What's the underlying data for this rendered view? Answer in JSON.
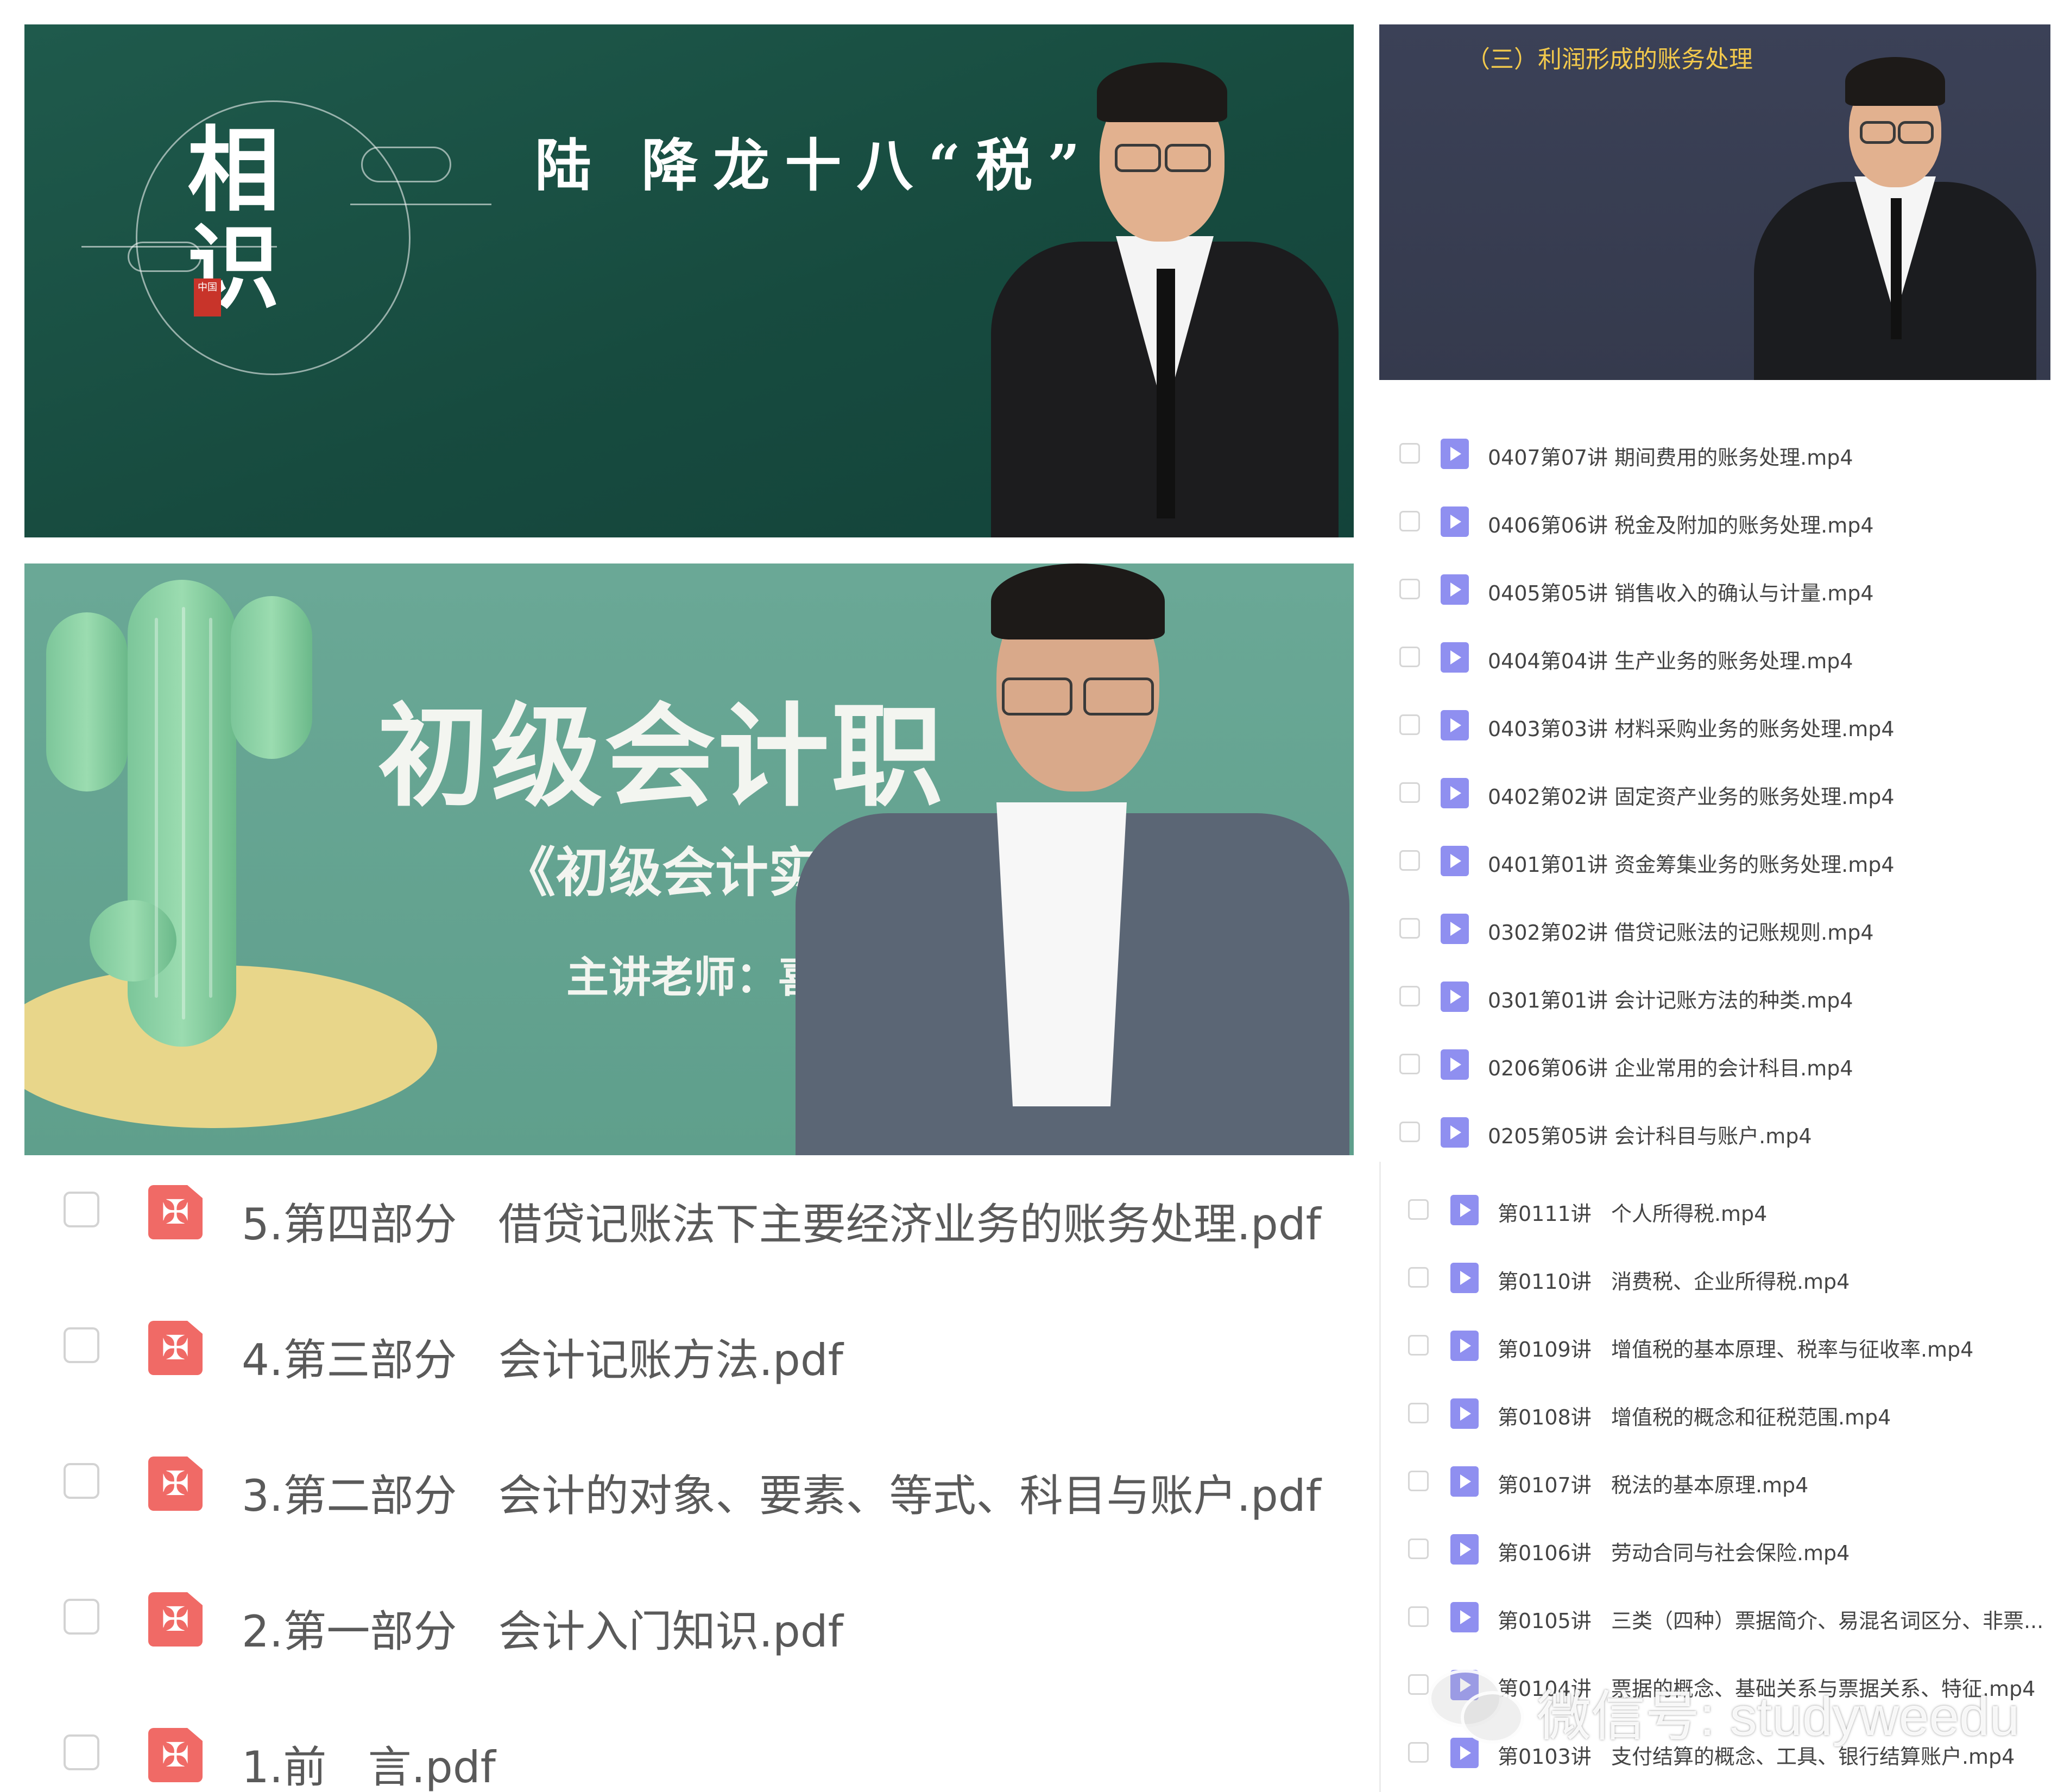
{
  "video1": {
    "logo_text": "相识",
    "logo_seal": "中国",
    "headline": "陆 降龙十八“税”"
  },
  "video2": {
    "slide_title": "（三）利润形成的账务处理"
  },
  "video3": {
    "title": "初级会计职",
    "subtitle": "《初级会计实务》",
    "lecturer": "主讲老师：喜"
  },
  "pdf_files": [
    {
      "name": "5.第四部分   借贷记账法下主要经济业务的账务处理.pdf"
    },
    {
      "name": "4.第三部分   会计记账方法.pdf"
    },
    {
      "name": "3.第二部分   会计的对象、要素、等式、科目与账户.pdf"
    },
    {
      "name": "2.第一部分   会计入门知识.pdf"
    },
    {
      "name": "1.前   言.pdf"
    }
  ],
  "mp4_files_a": [
    {
      "name": "0407第07讲 期间费用的账务处理.mp4"
    },
    {
      "name": "0406第06讲 税金及附加的账务处理.mp4"
    },
    {
      "name": "0405第05讲 销售收入的确认与计量.mp4"
    },
    {
      "name": "0404第04讲 生产业务的账务处理.mp4"
    },
    {
      "name": "0403第03讲 材料采购业务的账务处理.mp4"
    },
    {
      "name": "0402第02讲 固定资产业务的账务处理.mp4"
    },
    {
      "name": "0401第01讲 资金筹集业务的账务处理.mp4"
    },
    {
      "name": "0302第02讲 借贷记账法的记账规则.mp4"
    },
    {
      "name": "0301第01讲 会计记账方法的种类.mp4"
    },
    {
      "name": "0206第06讲 企业常用的会计科目.mp4"
    },
    {
      "name": "0205第05讲 会计科目与账户.mp4"
    }
  ],
  "mp4_files_b": [
    {
      "name": "第0111讲   个人所得税.mp4"
    },
    {
      "name": "第0110讲   消费税、企业所得税.mp4"
    },
    {
      "name": "第0109讲   增值税的基本原理、税率与征收率.mp4"
    },
    {
      "name": "第0108讲   增值税的概念和征税范围.mp4"
    },
    {
      "name": "第0107讲   税法的基本原理.mp4"
    },
    {
      "name": "第0106讲   劳动合同与社会保险.mp4"
    },
    {
      "name": "第0105讲   三类（四种）票据简介、易混名词区分、非票..."
    },
    {
      "name": "第0104讲   票据的概念、基础关系与票据关系、特征.mp4"
    },
    {
      "name": "第0103讲   支付结算的概念、工具、银行结算账户.mp4"
    }
  ],
  "watermark": {
    "text": "微信号: studyweedu"
  },
  "colors": {
    "pdf_icon": "#f06a66",
    "mp4_icon": "#8f8ff0",
    "video1_bg": "#174b3f",
    "video2_bg": "#353a4d",
    "video3_bg": "#5f9f8c"
  }
}
